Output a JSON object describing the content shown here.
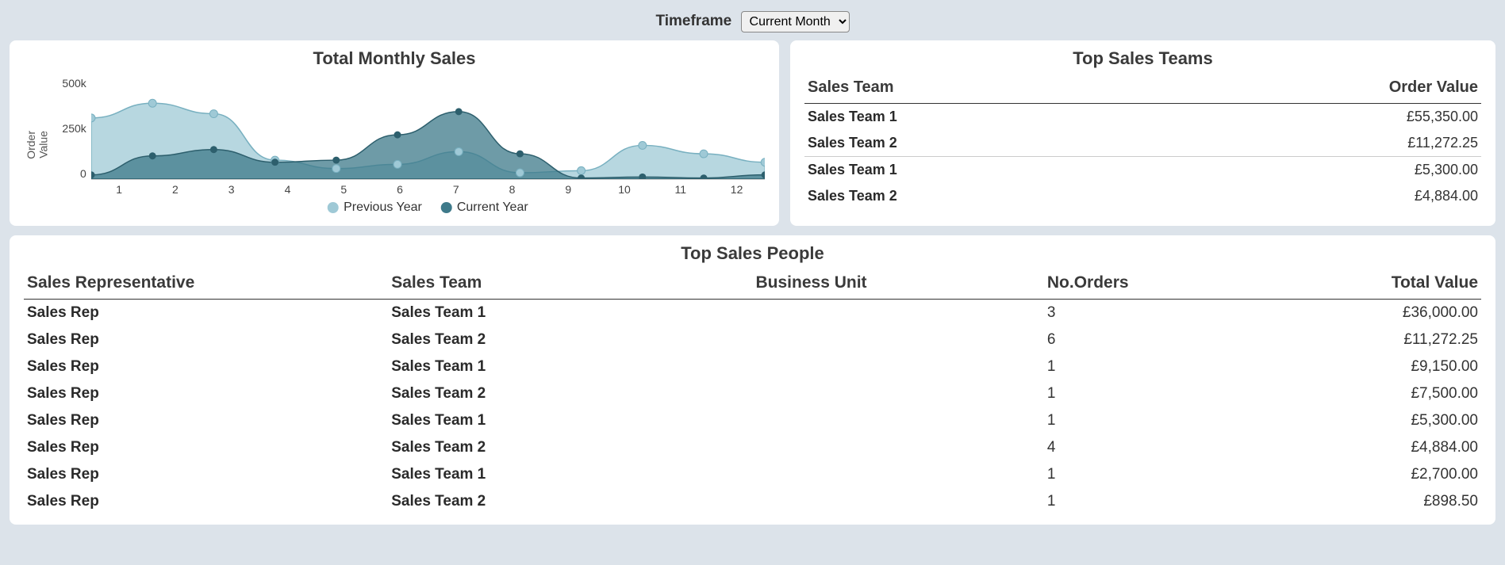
{
  "header": {
    "label": "Timeframe",
    "selected": "Current Month"
  },
  "chart_panel": {
    "title": "Total Monthly Sales",
    "ylabel_line1": "Order",
    "ylabel_line2": "Value",
    "legend_prev": "Previous Year",
    "legend_curr": "Current Year"
  },
  "chart_data": {
    "type": "area",
    "categories": [
      "1",
      "2",
      "3",
      "4",
      "5",
      "6",
      "7",
      "8",
      "9",
      "10",
      "11",
      "12"
    ],
    "series": [
      {
        "name": "Previous Year",
        "color": "#9fc9d6",
        "values": [
          290000,
          360000,
          310000,
          90000,
          50000,
          70000,
          130000,
          30000,
          40000,
          160000,
          120000,
          80000
        ]
      },
      {
        "name": "Current Year",
        "color": "#3e7a8a",
        "values": [
          20000,
          110000,
          140000,
          80000,
          90000,
          210000,
          320000,
          120000,
          5000,
          10000,
          5000,
          20000
        ]
      }
    ],
    "yticks": [
      "500k",
      "250k",
      "0"
    ],
    "ylim": [
      0,
      500000
    ],
    "title": "Total Monthly Sales",
    "xlabel": "",
    "ylabel": "Order Value"
  },
  "teams_panel": {
    "title": "Top Sales Teams",
    "columns": {
      "team": "Sales Team",
      "value": "Order Value"
    },
    "rows": [
      {
        "team": "Sales Team 1",
        "value": "£55,350.00"
      },
      {
        "team": "Sales Team 2",
        "value": "£11,272.25"
      },
      {
        "team": "Sales Team 1",
        "value": "£5,300.00"
      },
      {
        "team": "Sales Team 2",
        "value": "£4,884.00"
      }
    ]
  },
  "people_panel": {
    "title": "Top Sales People",
    "columns": {
      "rep": "Sales Representative",
      "team": "Sales Team",
      "bu": "Business Unit",
      "orders": "No.Orders",
      "total": "Total Value"
    },
    "rows": [
      {
        "rep": "Sales Rep",
        "team": "Sales Team 1",
        "bu": "",
        "orders": "3",
        "total": "£36,000.00"
      },
      {
        "rep": "Sales Rep",
        "team": "Sales Team 2",
        "bu": "",
        "orders": "6",
        "total": "£11,272.25"
      },
      {
        "rep": "Sales Rep",
        "team": "Sales Team 1",
        "bu": "",
        "orders": "1",
        "total": "£9,150.00"
      },
      {
        "rep": "Sales Rep",
        "team": "Sales Team 2",
        "bu": "",
        "orders": "1",
        "total": "£7,500.00"
      },
      {
        "rep": "Sales Rep",
        "team": "Sales Team 1",
        "bu": "",
        "orders": "1",
        "total": "£5,300.00"
      },
      {
        "rep": "Sales Rep",
        "team": "Sales Team 2",
        "bu": "",
        "orders": "4",
        "total": "£4,884.00"
      },
      {
        "rep": "Sales Rep",
        "team": "Sales Team 1",
        "bu": "",
        "orders": "1",
        "total": "£2,700.00"
      },
      {
        "rep": "Sales Rep",
        "team": "Sales Team 2",
        "bu": "",
        "orders": "1",
        "total": "£898.50"
      }
    ]
  }
}
